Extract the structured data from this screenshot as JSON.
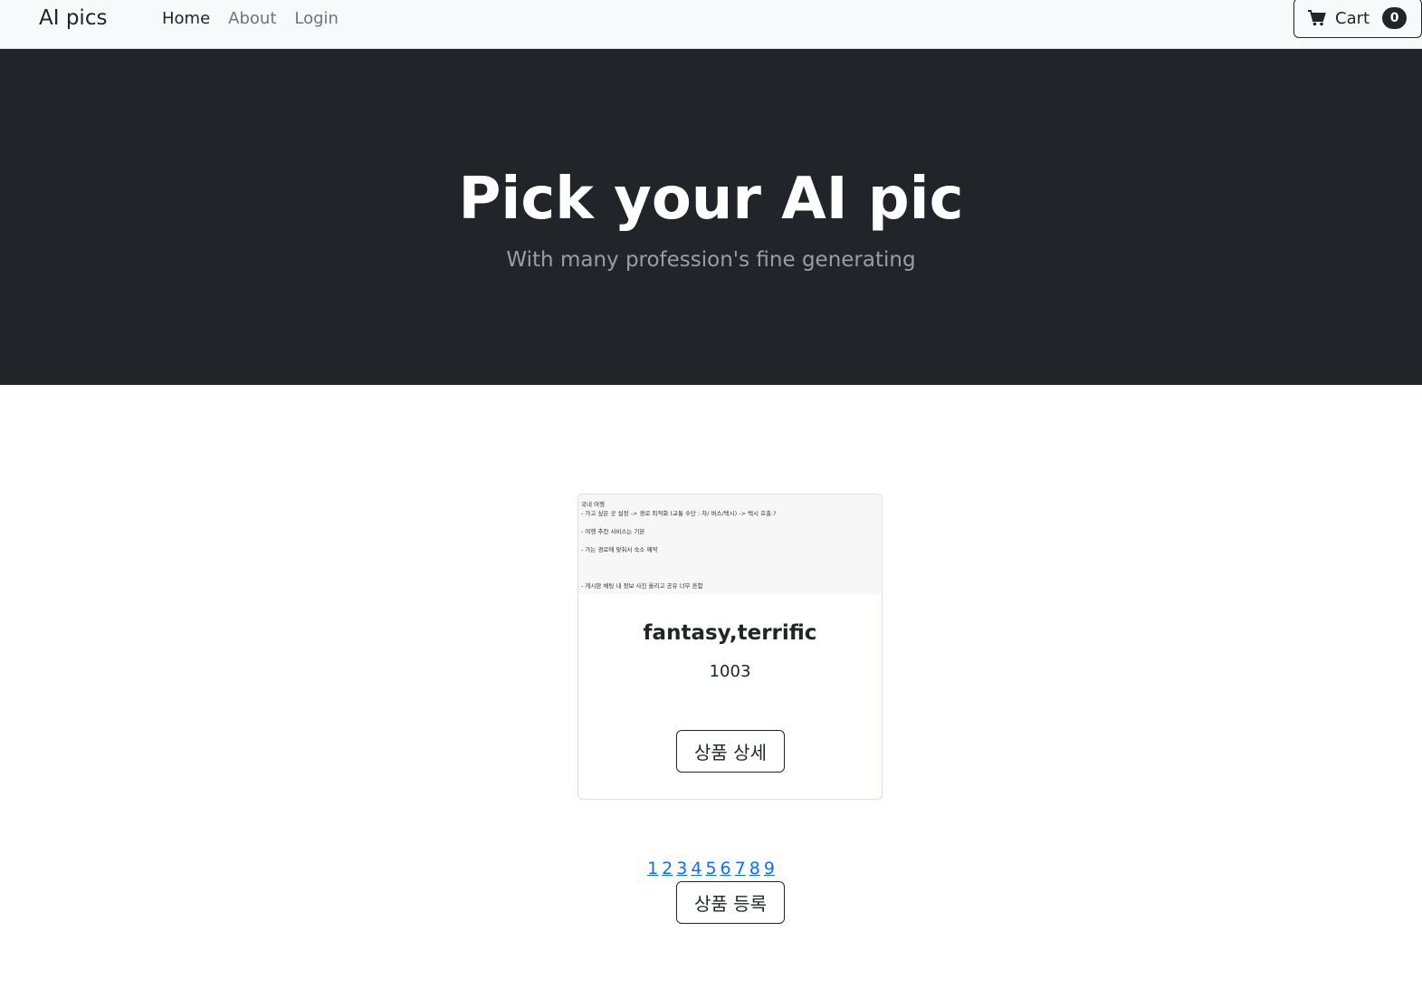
{
  "navbar": {
    "brand": "AI pics",
    "links": [
      {
        "label": "Home",
        "active": true
      },
      {
        "label": "About",
        "active": false
      },
      {
        "label": "Login",
        "active": false
      }
    ],
    "cart": {
      "label": "Cart",
      "count": "0",
      "icon": "cart-icon"
    }
  },
  "hero": {
    "title": "Pick your AI pic",
    "subtitle": "With many profession's fine generating"
  },
  "product": {
    "image_text": "국내 여행\n- 가고 싶은 곳 설정 -> 경로 최적화 (교통 수단 : 차/ 버스/택시) -> 택시 호출.?\n\n- 여행 추천 서비스는 기본\n\n- 가는 경로에 맞춰서 숙소 예약\n\n\n\n- 게시판 채팅 내 정보 사진 올리고 공유 너무 흔함",
    "title": "fantasy,terrific",
    "price": "1003",
    "detail_button": "상품 상세"
  },
  "pagination": {
    "pages": [
      "1",
      "2",
      "3",
      "4",
      "5",
      "6",
      "7",
      "8",
      "9"
    ]
  },
  "register_button": "상품 등록",
  "colors": {
    "navbar_bg": "#f8f9fa",
    "hero_bg": "#212529",
    "link": "#0d6efd"
  }
}
